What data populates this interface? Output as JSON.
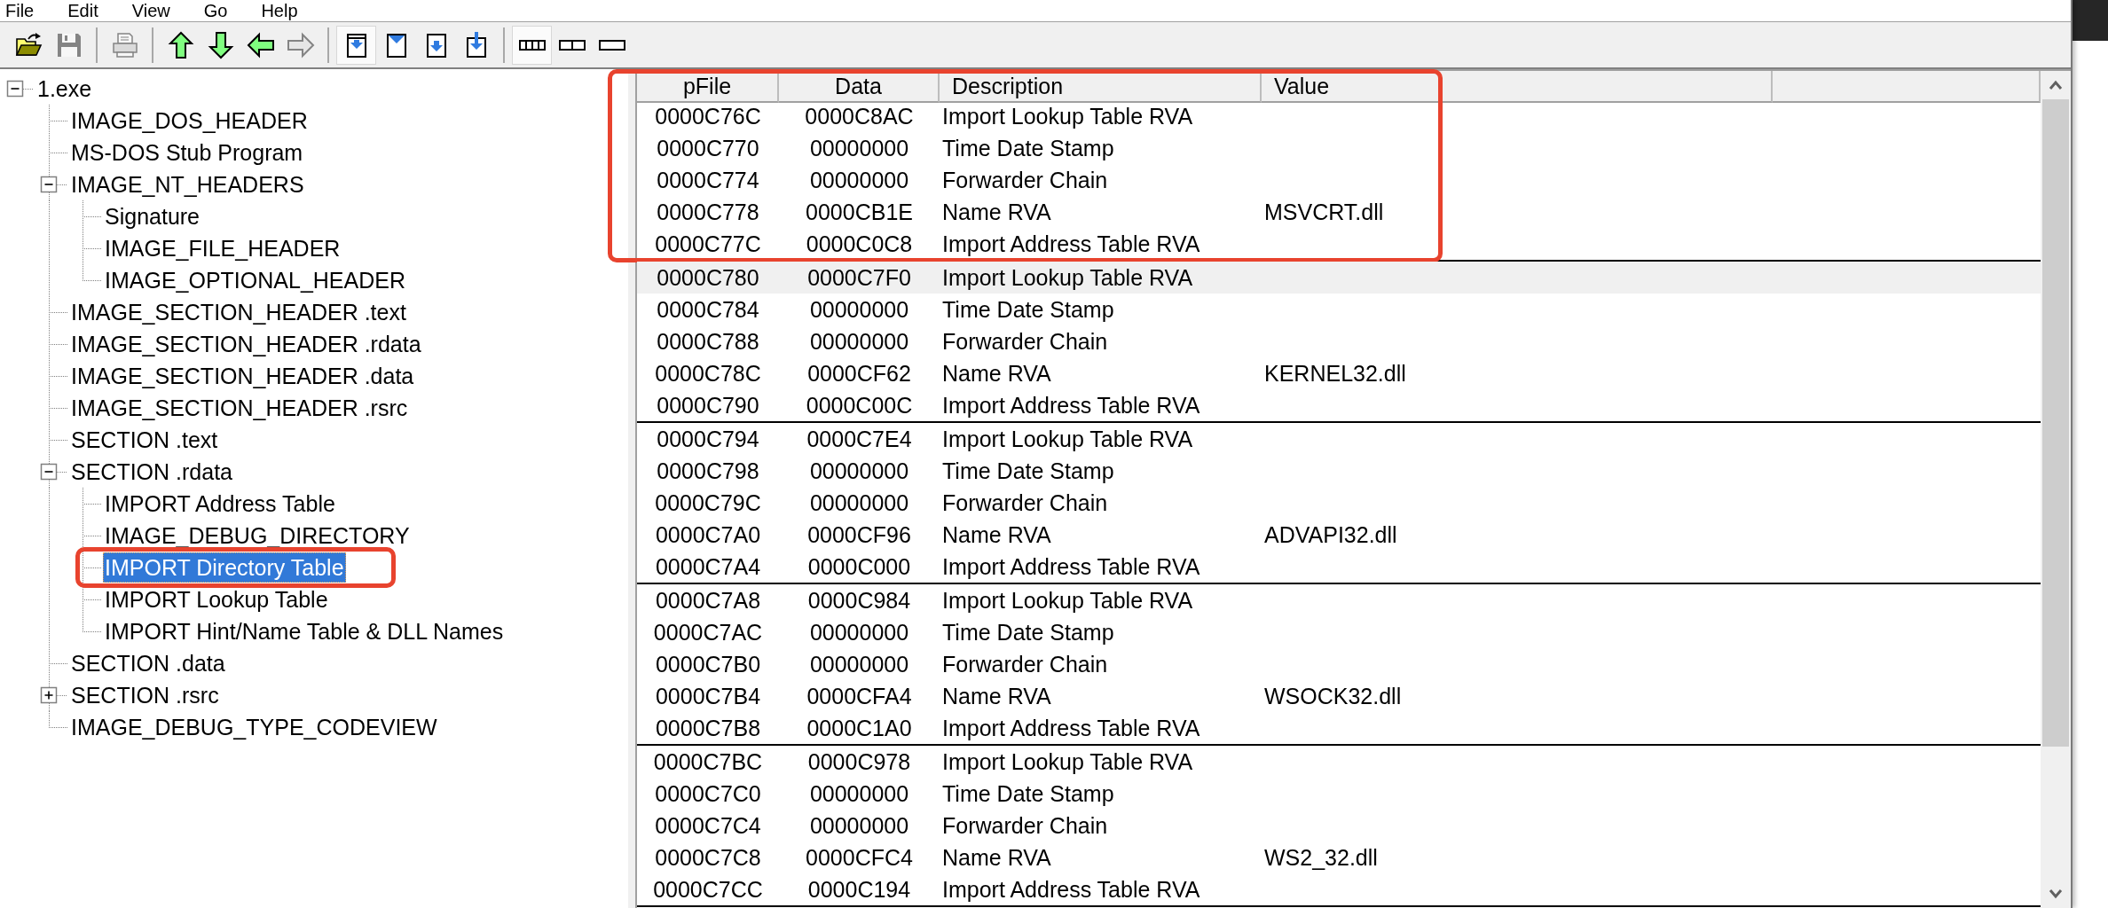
{
  "menu": [
    "File",
    "Edit",
    "View",
    "Go",
    "Help"
  ],
  "toolbar": [
    [
      {
        "disabled": false
      },
      {
        "disabled": true
      }
    ],
    [
      {
        "disabled": true
      }
    ],
    [
      {
        "disabled": false
      },
      {
        "disabled": false
      },
      {
        "disabled": false
      },
      {
        "disabled": true
      }
    ],
    [
      {
        "selected": true
      },
      {
        "selected": false
      },
      {
        "selected": false
      },
      {
        "selected": false
      }
    ],
    [
      {
        "selected": true
      },
      {
        "selected": false
      },
      {
        "selected": false
      }
    ]
  ],
  "tree": [
    {
      "label": "1.exe",
      "expanded": true,
      "selected": false,
      "children": [
        {
          "label": "IMAGE_DOS_HEADER",
          "selected": false
        },
        {
          "label": "MS-DOS Stub Program",
          "selected": false
        },
        {
          "label": "IMAGE_NT_HEADERS",
          "expanded": true,
          "selected": false,
          "children": [
            {
              "label": "Signature",
              "selected": false
            },
            {
              "label": "IMAGE_FILE_HEADER",
              "selected": false
            },
            {
              "label": "IMAGE_OPTIONAL_HEADER",
              "selected": false
            }
          ]
        },
        {
          "label": "IMAGE_SECTION_HEADER .text",
          "selected": false
        },
        {
          "label": "IMAGE_SECTION_HEADER .rdata",
          "selected": false
        },
        {
          "label": "IMAGE_SECTION_HEADER .data",
          "selected": false
        },
        {
          "label": "IMAGE_SECTION_HEADER .rsrc",
          "selected": false
        },
        {
          "label": "SECTION .text",
          "selected": false
        },
        {
          "label": "SECTION .rdata",
          "expanded": true,
          "selected": false,
          "children": [
            {
              "label": "IMPORT Address Table",
              "selected": false
            },
            {
              "label": "IMAGE_DEBUG_DIRECTORY",
              "selected": false
            },
            {
              "label": "IMPORT Directory Table",
              "selected": true,
              "outlined": true
            },
            {
              "label": "IMPORT Lookup Table",
              "selected": false
            },
            {
              "label": "IMPORT Hint/Name Table & DLL Names",
              "selected": false
            }
          ]
        },
        {
          "label": "SECTION .data",
          "selected": false
        },
        {
          "label": "SECTION .rsrc",
          "expanded": false,
          "selected": false
        },
        {
          "label": "IMAGE_DEBUG_TYPE_CODEVIEW",
          "selected": false
        }
      ]
    }
  ],
  "table": {
    "columns": [
      "pFile",
      "Data",
      "Description",
      "Value"
    ],
    "groups": [
      {
        "outlined": true,
        "rows": [
          {
            "pfile": "0000C76C",
            "data": "0000C8AC",
            "description": "Import Lookup Table RVA",
            "selected": false
          },
          {
            "pfile": "0000C770",
            "data": "00000000",
            "description": "Time Date Stamp",
            "selected": false
          },
          {
            "pfile": "0000C774",
            "data": "00000000",
            "description": "Forwarder Chain",
            "selected": false
          },
          {
            "pfile": "0000C778",
            "data": "0000CB1E",
            "description": "Name RVA",
            "value": "MSVCRT.dll",
            "selected": false
          },
          {
            "pfile": "0000C77C",
            "data": "0000C0C8",
            "description": "Import Address Table RVA",
            "selected": false
          }
        ]
      },
      {
        "rows": [
          {
            "pfile": "0000C780",
            "data": "0000C7F0",
            "description": "Import Lookup Table RVA",
            "selected": true
          },
          {
            "pfile": "0000C784",
            "data": "00000000",
            "description": "Time Date Stamp",
            "selected": false
          },
          {
            "pfile": "0000C788",
            "data": "00000000",
            "description": "Forwarder Chain",
            "selected": false
          },
          {
            "pfile": "0000C78C",
            "data": "0000CF62",
            "description": "Name RVA",
            "value": "KERNEL32.dll",
            "selected": false
          },
          {
            "pfile": "0000C790",
            "data": "0000C00C",
            "description": "Import Address Table RVA",
            "selected": false
          }
        ]
      },
      {
        "rows": [
          {
            "pfile": "0000C794",
            "data": "0000C7E4",
            "description": "Import Lookup Table RVA",
            "selected": false
          },
          {
            "pfile": "0000C798",
            "data": "00000000",
            "description": "Time Date Stamp",
            "selected": false
          },
          {
            "pfile": "0000C79C",
            "data": "00000000",
            "description": "Forwarder Chain",
            "selected": false
          },
          {
            "pfile": "0000C7A0",
            "data": "0000CF96",
            "description": "Name RVA",
            "value": "ADVAPI32.dll",
            "selected": false
          },
          {
            "pfile": "0000C7A4",
            "data": "0000C000",
            "description": "Import Address Table RVA",
            "selected": false
          }
        ]
      },
      {
        "rows": [
          {
            "pfile": "0000C7A8",
            "data": "0000C984",
            "description": "Import Lookup Table RVA",
            "selected": false
          },
          {
            "pfile": "0000C7AC",
            "data": "00000000",
            "description": "Time Date Stamp",
            "selected": false
          },
          {
            "pfile": "0000C7B0",
            "data": "00000000",
            "description": "Forwarder Chain",
            "selected": false
          },
          {
            "pfile": "0000C7B4",
            "data": "0000CFA4",
            "description": "Name RVA",
            "value": "WSOCK32.dll",
            "selected": false
          },
          {
            "pfile": "0000C7B8",
            "data": "0000C1A0",
            "description": "Import Address Table RVA",
            "selected": false
          }
        ]
      },
      {
        "rows": [
          {
            "pfile": "0000C7BC",
            "data": "0000C978",
            "description": "Import Lookup Table RVA",
            "selected": false
          },
          {
            "pfile": "0000C7C0",
            "data": "00000000",
            "description": "Time Date Stamp",
            "selected": false
          },
          {
            "pfile": "0000C7C4",
            "data": "00000000",
            "description": "Forwarder Chain",
            "selected": false
          },
          {
            "pfile": "0000C7C8",
            "data": "0000CFC4",
            "description": "Name RVA",
            "value": "WS2_32.dll",
            "selected": false
          },
          {
            "pfile": "0000C7CC",
            "data": "0000C194",
            "description": "Import Address Table RVA",
            "selected": false
          }
        ]
      }
    ]
  }
}
